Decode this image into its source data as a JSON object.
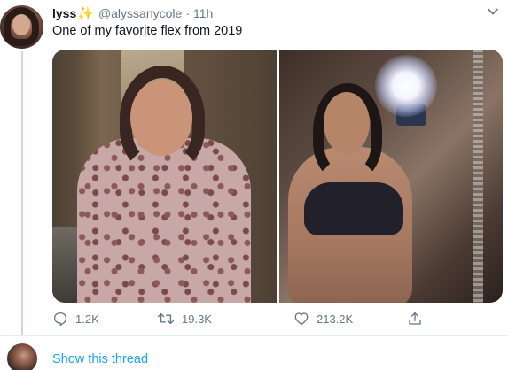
{
  "tweet": {
    "display_name": "lyss",
    "handle": "@alyssanycole",
    "separator": "·",
    "time": "11h",
    "text": "One of my favorite flex from 2019",
    "sparkle_icon": "sparkles-icon"
  },
  "media": {
    "count": 2
  },
  "actions": {
    "reply_count": "1.2K",
    "retweet_count": "19.3K",
    "like_count": "213.2K"
  },
  "thread": {
    "show_label": "Show this thread"
  },
  "colors": {
    "accent": "#1da1f2",
    "secondary_text": "#657786",
    "primary_text": "#14171a",
    "sparkle": "#f5b50a"
  }
}
